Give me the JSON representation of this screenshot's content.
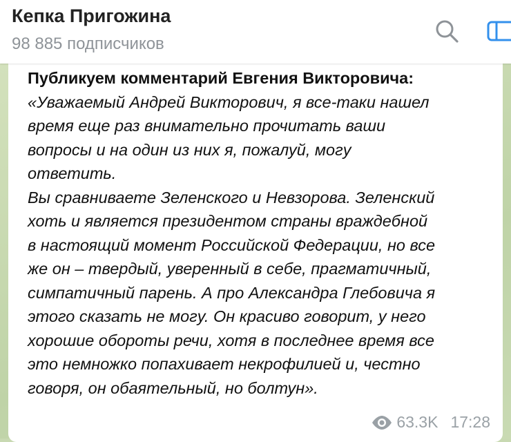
{
  "header": {
    "channel_name": "Кепка Пригожина",
    "subscribers": "98 885 подписчиков",
    "icons": [
      "search-icon",
      "sidebar-toggle-icon"
    ]
  },
  "post": {
    "headline": "Публикуем комментарий Евгения Викторовича:",
    "lines": [
      "«Уважаемый Андрей Викторович, я все-таки нашел",
      "время еще раз внимательно прочитать ваши",
      "вопросы и на один из них я, пожалуй, могу",
      "ответить.",
      "Вы сравниваете Зеленского и Невзорова.  Зеленский",
      "хоть и является президентом страны враждебной",
      "в настоящий момент Российской Федерации, но все",
      "же он – твердый, уверенный в себе, прагматичный,",
      "симпатичный парень. А про Александра Глебовича я",
      "этого сказать не могу. Он красиво говорит, у него",
      "хорошие обороты речи, хотя в последнее время все",
      "это немножко попахивает некрофилией и, честно",
      "говоря, он обаятельный, но болтун»."
    ],
    "views": "63.3K",
    "time": "17:28",
    "icons": [
      "eye-icon"
    ]
  },
  "colors": {
    "header_bg": "#ffffff",
    "chat_bg": "#c8d9b2",
    "bubble_bg": "#ffffff",
    "meta_text": "#9aa1a6",
    "icon_gray": "#8e9398",
    "icon_blue": "#3390ec"
  }
}
